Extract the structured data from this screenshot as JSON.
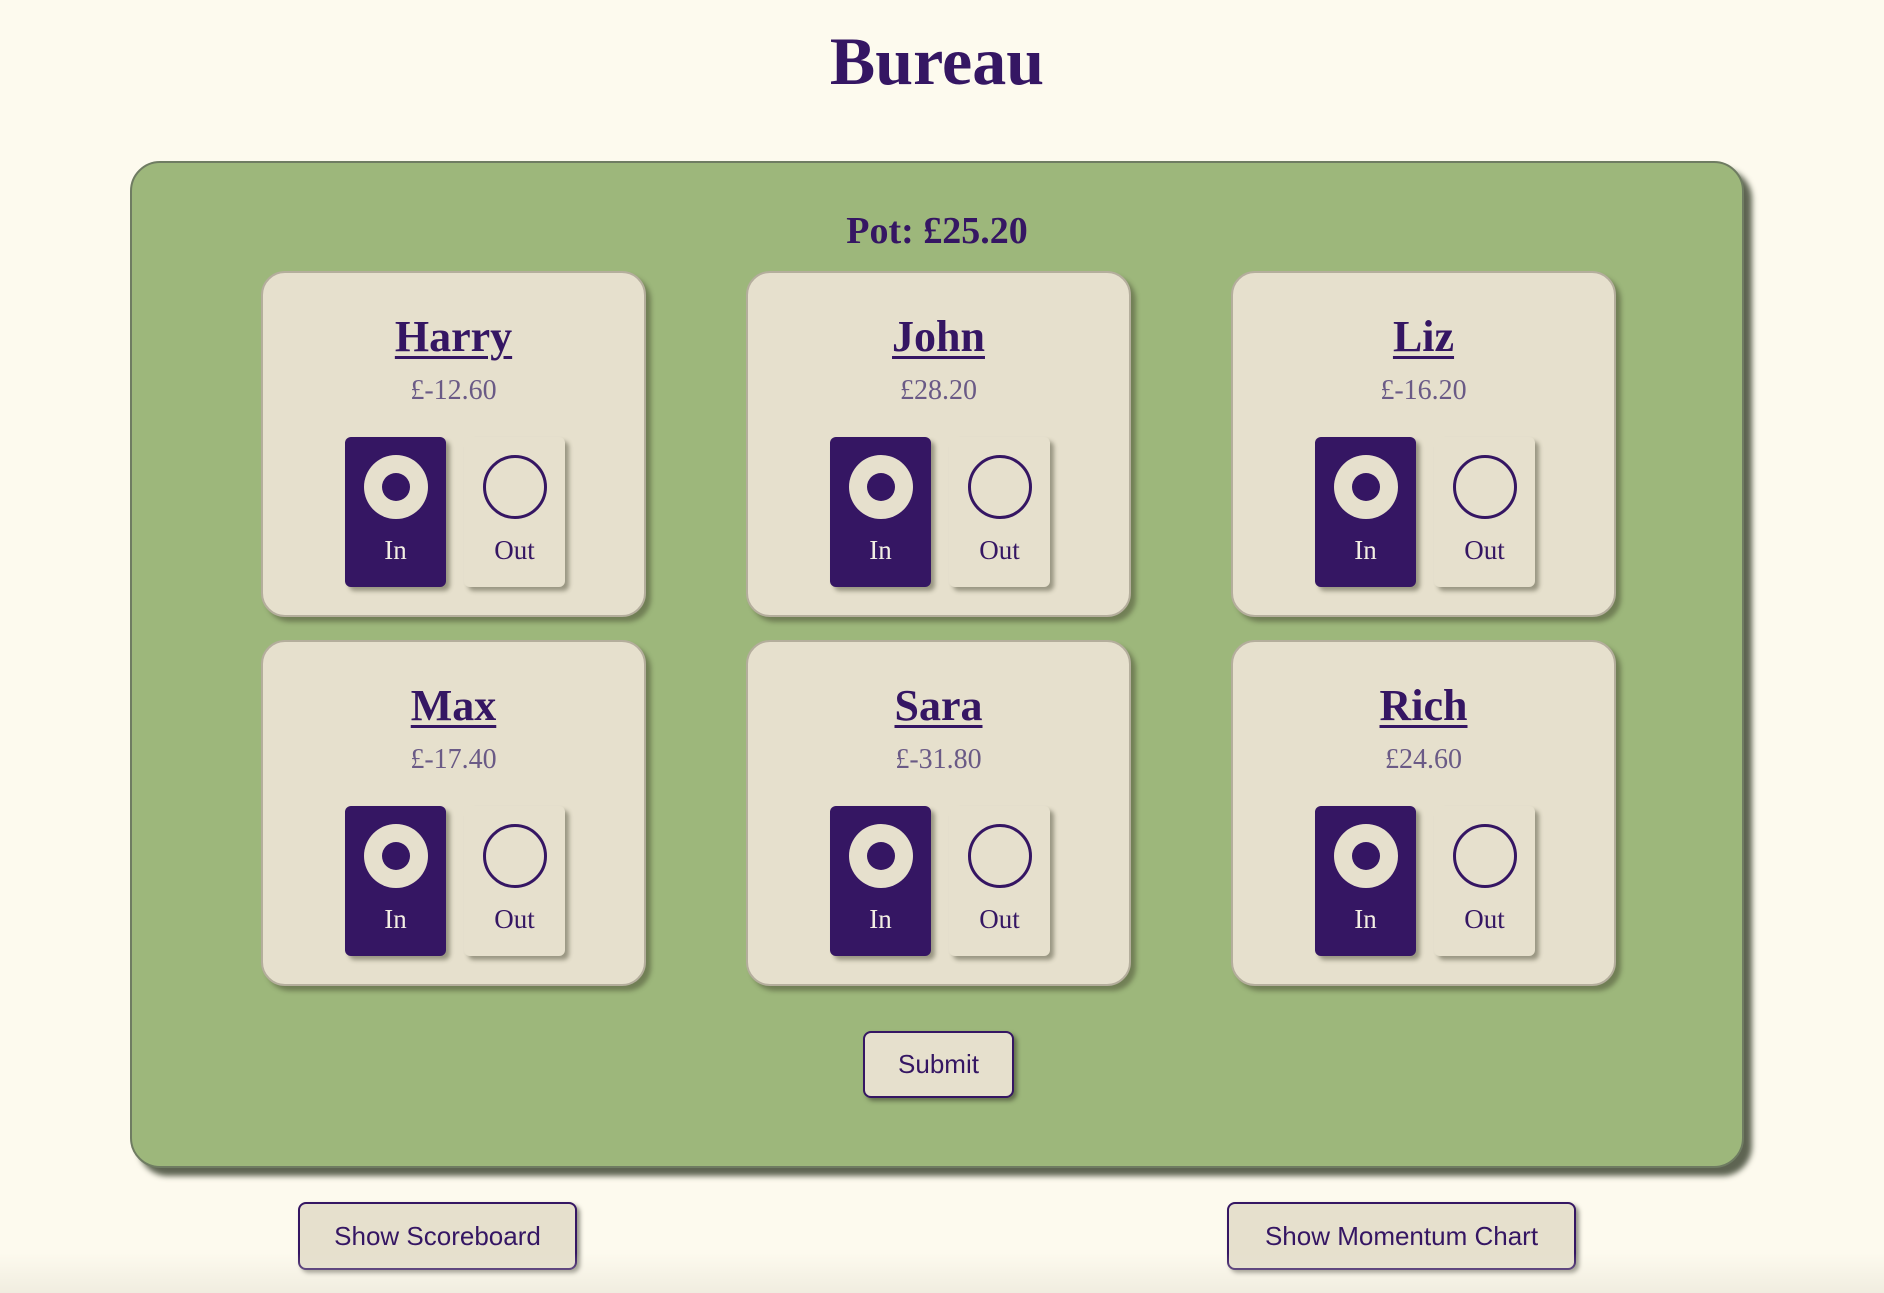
{
  "title": "Bureau",
  "pot": "Pot: £25.20",
  "players": [
    {
      "name": "Harry",
      "balance": "£-12.60",
      "in_label": "In",
      "out_label": "Out",
      "selected": "In"
    },
    {
      "name": "John",
      "balance": "£28.20",
      "in_label": "In",
      "out_label": "Out",
      "selected": "In"
    },
    {
      "name": "Liz",
      "balance": "£-16.20",
      "in_label": "In",
      "out_label": "Out",
      "selected": "In"
    },
    {
      "name": "Max",
      "balance": "£-17.40",
      "in_label": "In",
      "out_label": "Out",
      "selected": "In"
    },
    {
      "name": "Sara",
      "balance": "£-31.80",
      "in_label": "In",
      "out_label": "Out",
      "selected": "In"
    },
    {
      "name": "Rich",
      "balance": "£24.60",
      "in_label": "In",
      "out_label": "Out",
      "selected": "In"
    }
  ],
  "submit_label": "Submit",
  "show_scoreboard_label": "Show Scoreboard",
  "show_momentum_label": "Show Momentum Chart",
  "colors": {
    "background": "#fdfaee",
    "board": "#9db77b",
    "card": "#e6e0cd",
    "accent": "#351663"
  }
}
